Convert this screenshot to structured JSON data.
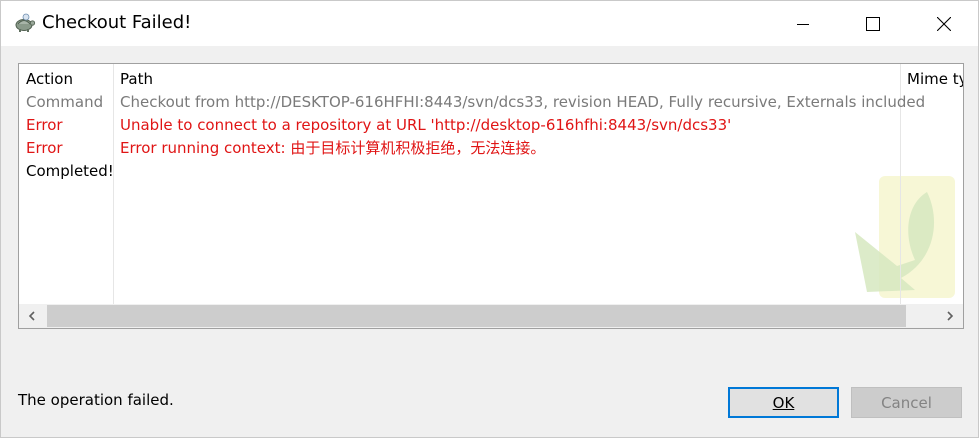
{
  "window": {
    "title": "Checkout Failed!"
  },
  "list": {
    "columns": [
      "Action",
      "Path",
      "Mime ty"
    ],
    "rows": [
      {
        "action": "Command",
        "path": "Checkout from http://DESKTOP-616HFHI:8443/svn/dcs33, revision HEAD, Fully recursive, Externals included",
        "kind": "command"
      },
      {
        "action": "Error",
        "path": "Unable to connect to a repository at URL 'http://desktop-616hfhi:8443/svn/dcs33'",
        "kind": "error"
      },
      {
        "action": "Error",
        "path": "Error running context: 由于目标计算机积极拒绝，无法连接。",
        "kind": "error"
      },
      {
        "action": "Completed!",
        "path": "",
        "kind": "done"
      }
    ]
  },
  "footer": {
    "status": "The operation failed.",
    "ok_label": "OK",
    "cancel_label": "Cancel"
  },
  "colors": {
    "error": "#e01515",
    "command": "#7a7a7a",
    "focus": "#0078d7"
  },
  "icons": {
    "app": "tortoise-icon",
    "minimize": "minimize-icon",
    "maximize": "maximize-icon",
    "close": "close-icon",
    "watermark": "checkout-arrow-icon",
    "scroll_left": "chevron-left-icon",
    "scroll_right": "chevron-right-icon"
  }
}
